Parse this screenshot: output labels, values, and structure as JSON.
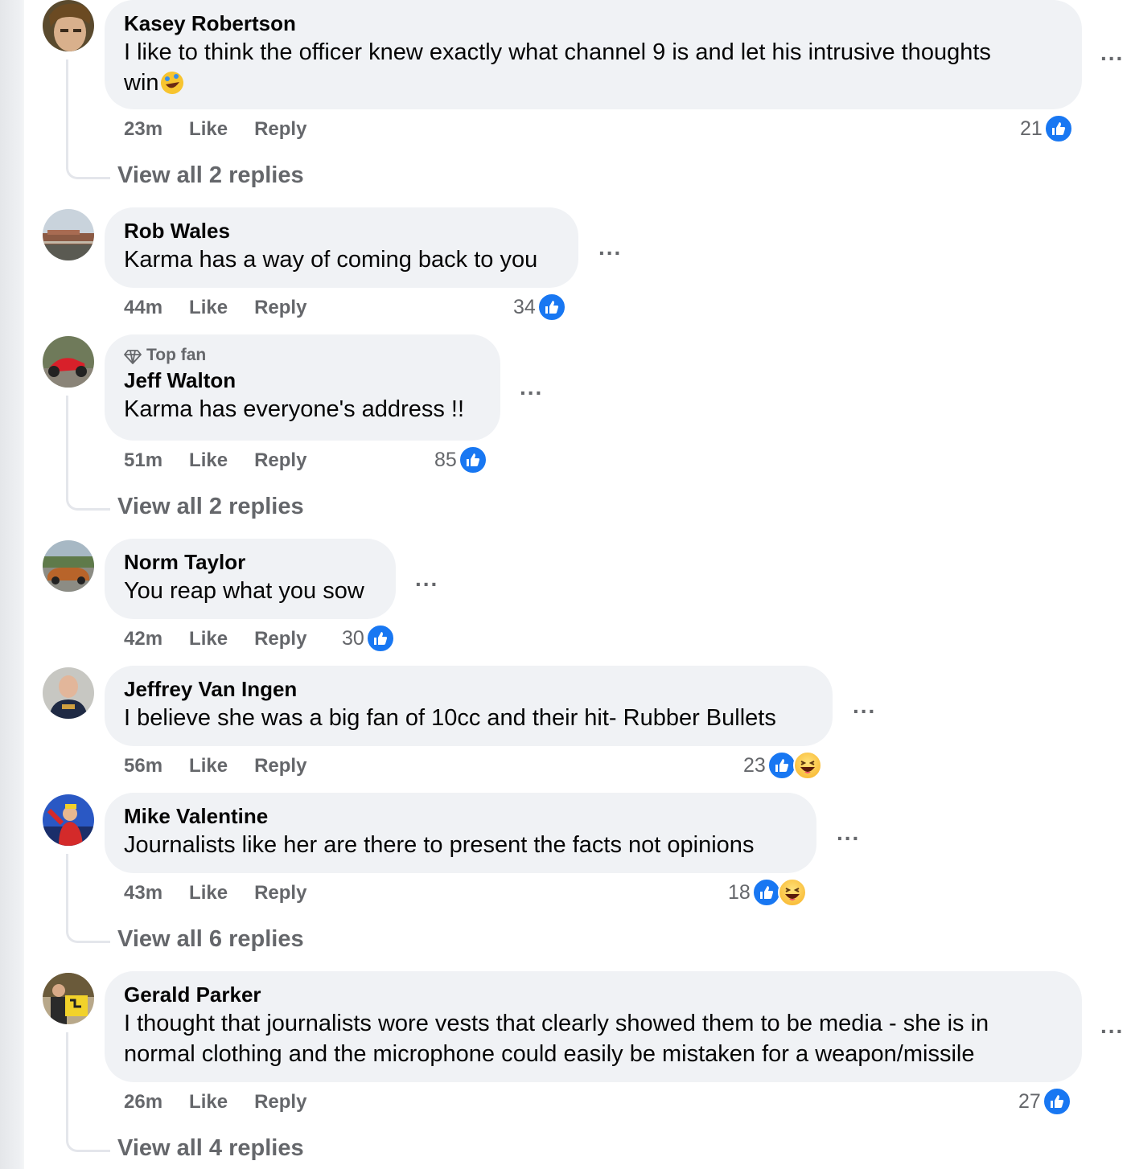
{
  "comments": [
    {
      "author": "Kasey Robertson",
      "text_lines": [
        "I like to think the officer knew exactly what channel 9 is and let his intrusive thoughts",
        "win"
      ],
      "inline_emoji": "rolling-on-floor-laughing-emoji",
      "time": "23m",
      "like": "Like",
      "reply": "Reply",
      "reactions_count": "21",
      "reactions": [
        "like"
      ],
      "view_replies": "View all 2 replies"
    },
    {
      "author": "Rob Wales",
      "text_lines": [
        "Karma has a way of coming back to you"
      ],
      "time": "44m",
      "like": "Like",
      "reply": "Reply",
      "reactions_count": "34",
      "reactions": [
        "like"
      ]
    },
    {
      "badge": "Top fan",
      "badge_icon": "diamond-icon",
      "author": "Jeff Walton",
      "text_lines": [
        "Karma has everyone's address !!"
      ],
      "time": "51m",
      "like": "Like",
      "reply": "Reply",
      "reactions_count": "85",
      "reactions": [
        "like"
      ],
      "view_replies": "View all 2 replies"
    },
    {
      "author": "Norm Taylor",
      "text_lines": [
        "You reap what you sow"
      ],
      "time": "42m",
      "like": "Like",
      "reply": "Reply",
      "reactions_count": "30",
      "reactions": [
        "like"
      ]
    },
    {
      "author": "Jeffrey Van Ingen",
      "text_lines": [
        "I believe she was a big fan of 10cc and their hit- Rubber Bullets"
      ],
      "time": "56m",
      "like": "Like",
      "reply": "Reply",
      "reactions_count": "23",
      "reactions": [
        "like",
        "haha"
      ]
    },
    {
      "author": "Mike Valentine",
      "text_lines": [
        "Journalists like her are there to present the facts not opinions"
      ],
      "time": "43m",
      "like": "Like",
      "reply": "Reply",
      "reactions_count": "18",
      "reactions": [
        "like",
        "haha"
      ],
      "view_replies": "View all 6 replies"
    },
    {
      "author": "Gerald Parker",
      "text_lines": [
        "I thought that journalists wore vests that clearly showed them to be media - she is in",
        "normal clothing and the microphone could easily be mistaken for a weapon/missile"
      ],
      "time": "26m",
      "like": "Like",
      "reply": "Reply",
      "reactions_count": "27",
      "reactions": [
        "like"
      ],
      "view_replies": "View all 4 replies"
    }
  ],
  "more_options_glyph": "...",
  "colors": {
    "bubble": "#f0f2f5",
    "meta_text": "#65676b",
    "like_blue": "#1877f2",
    "haha_yellow": "#f7b125"
  }
}
